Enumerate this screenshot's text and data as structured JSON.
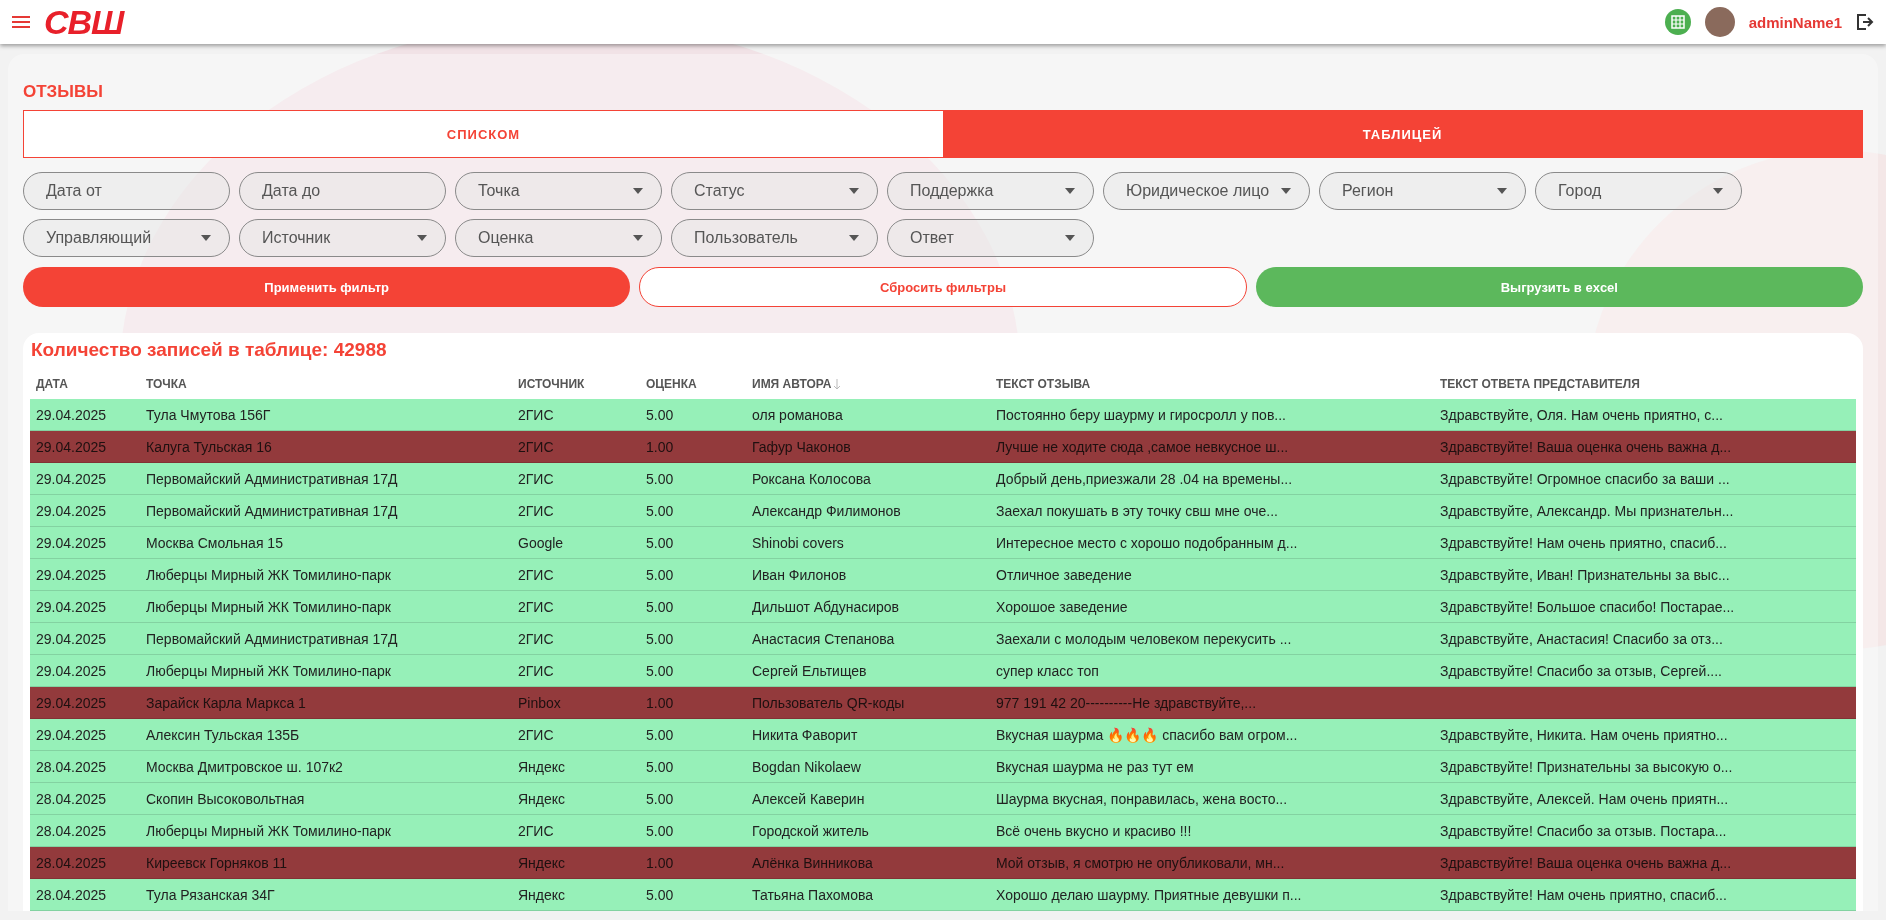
{
  "header": {
    "logo": "СВШ",
    "user": "adminName1"
  },
  "page_title": "ОТЗЫВЫ",
  "tabs": [
    {
      "label": "СПИСКОМ",
      "selected": false
    },
    {
      "label": "ТАБЛИЦЕЙ",
      "selected": true
    }
  ],
  "filters": [
    {
      "kind": "date",
      "placeholder": "Дата от"
    },
    {
      "kind": "date",
      "placeholder": "Дата до"
    },
    {
      "kind": "select",
      "label": "Точка"
    },
    {
      "kind": "select",
      "label": "Статус"
    },
    {
      "kind": "select",
      "label": "Поддержка"
    },
    {
      "kind": "select",
      "label": "Юридическое лицо"
    },
    {
      "kind": "select",
      "label": "Регион"
    },
    {
      "kind": "select",
      "label": "Город"
    },
    {
      "kind": "select",
      "label": "Управляющий"
    },
    {
      "kind": "select",
      "label": "Источник"
    },
    {
      "kind": "select",
      "label": "Оценка"
    },
    {
      "kind": "select",
      "label": "Пользователь"
    },
    {
      "kind": "select",
      "label": "Ответ"
    }
  ],
  "actions": [
    {
      "kind": "primary",
      "label": "Применить фильтр"
    },
    {
      "kind": "outline",
      "label": "Сбросить фильтры"
    },
    {
      "kind": "success",
      "label": "Выгрузить в excel"
    }
  ],
  "table": {
    "count_label": "Количество записей в таблице: 42988",
    "columns": [
      {
        "label": "ДАТА",
        "sorted": false
      },
      {
        "label": "ТОЧКА",
        "sorted": false
      },
      {
        "label": "ИСТОЧНИК",
        "sorted": false
      },
      {
        "label": "ОЦЕНКА",
        "sorted": false
      },
      {
        "label": "ИМЯ АВТОРА",
        "sorted": true
      },
      {
        "label": "ТЕКСТ ОТЗЫВА",
        "sorted": false
      },
      {
        "label": "ТЕКСТ ОТВЕТА ПРЕДСТАВИТЕЛЯ",
        "sorted": false
      }
    ],
    "rows": [
      {
        "color": "#96f0b8",
        "cells": [
          "29.04.2025",
          "Тула Чмутова 156Г",
          "2ГИС",
          "5.00",
          "оля романова",
          "Постоянно беру шаурму и гиросролл у пов...",
          "Здравствуйте, Оля. Нам очень приятно, с..."
        ]
      },
      {
        "color": "#933a3c",
        "cells": [
          "29.04.2025",
          "Калуга Тульская 16",
          "2ГИС",
          "1.00",
          "Гафур Чаконов",
          "Лучше не ходите сюда ,самое невкусное ш...",
          "Здравствуйте! Ваша оценка очень важна д..."
        ]
      },
      {
        "color": "#96f0b8",
        "cells": [
          "29.04.2025",
          "Первомайский Административная 17Д",
          "2ГИС",
          "5.00",
          "Роксана Колосова",
          "Добрый день,приезжали 28 .04 на времены...",
          "Здравствуйте! Огромное спасибо за ваши ..."
        ]
      },
      {
        "color": "#96f0b8",
        "cells": [
          "29.04.2025",
          "Первомайский Административная 17Д",
          "2ГИС",
          "5.00",
          "Александр Филимонов",
          "Заехал покушать в эту точку свш мне оче...",
          "Здравствуйте, Александр. Мы признательн..."
        ]
      },
      {
        "color": "#96f0b8",
        "cells": [
          "29.04.2025",
          "Москва Смольная 15",
          "Google",
          "5.00",
          "Shinobi covers",
          "Интересное место с хорошо подобранным д...",
          "Здравствуйте! Нам очень приятно, спасиб..."
        ]
      },
      {
        "color": "#96f0b8",
        "cells": [
          "29.04.2025",
          "Люберцы Мирный ЖК Томилино-парк",
          "2ГИС",
          "5.00",
          "Иван Филонов",
          "Отличное заведение",
          "Здравствуйте, Иван! Признательны за выс..."
        ]
      },
      {
        "color": "#96f0b8",
        "cells": [
          "29.04.2025",
          "Люберцы Мирный ЖК Томилино-парк",
          "2ГИС",
          "5.00",
          "Дильшот Абдунасиров",
          "Хорошое заведение",
          "Здравствуйте! Большое спасибо! Постарае..."
        ]
      },
      {
        "color": "#96f0b8",
        "cells": [
          "29.04.2025",
          "Первомайский Административная 17Д",
          "2ГИС",
          "5.00",
          "Анастасия Степанова",
          "Заехали с молодым человеком перекусить ...",
          "Здравствуйте, Анастасия! Спасибо за отз..."
        ]
      },
      {
        "color": "#96f0b8",
        "cells": [
          "29.04.2025",
          "Люберцы Мирный ЖК Томилино-парк",
          "2ГИС",
          "5.00",
          "Сергей Ельтищев",
          "супер класс топ",
          "Здравствуйте! Спасибо за отзыв, Сергей...."
        ]
      },
      {
        "color": "#933a3c",
        "cells": [
          "29.04.2025",
          "Зарайск Карла Маркса 1",
          "Pinbox",
          "1.00",
          "Пользователь QR-коды",
          "977 191 42 20----------Не здравствуйте,...",
          null
        ]
      },
      {
        "color": "#96f0b8",
        "cells": [
          "29.04.2025",
          "Алексин Тульская 135Б",
          "2ГИС",
          "5.00",
          "Никита Фаворит",
          "Вкусная шаурма 🔥🔥🔥 спасибо вам огром...",
          "Здравствуйте, Никита. Нам очень приятно..."
        ]
      },
      {
        "color": "#96f0b8",
        "cells": [
          "28.04.2025",
          "Москва Дмитровское ш. 107к2",
          "Яндекс",
          "5.00",
          "Bogdan Nikolaew",
          "Вкусная шаурма не раз тут ем",
          "Здравствуйте! Признательны за высокую о..."
        ]
      },
      {
        "color": "#96f0b8",
        "cells": [
          "28.04.2025",
          "Скопин Высоковольтная",
          "Яндекс",
          "5.00",
          "Алексей Каверин",
          "Шаурма вкусная, понравилась, жена восто...",
          "Здравствуйте, Алексей. Нам очень приятн..."
        ]
      },
      {
        "color": "#96f0b8",
        "cells": [
          "28.04.2025",
          "Люберцы Мирный ЖК Томилино-парк",
          "2ГИС",
          "5.00",
          "Городской житель",
          "Всё очень вкусно и красиво !!!",
          "Здравствуйте! Спасибо за отзыв. Постара..."
        ]
      },
      {
        "color": "#933a3c",
        "cells": [
          "28.04.2025",
          "Киреевск Горняков 11",
          "Яндекс",
          "1.00",
          "Алёнка Винникова",
          "Мой отзыв, я смотрю не опубликовали, мн...",
          "Здравствуйте! Ваша оценка очень важна д..."
        ]
      },
      {
        "color": "#96f0b8",
        "cells": [
          "28.04.2025",
          "Тула Рязанская 34Г",
          "Яндекс",
          "5.00",
          "Татьяна Пахомова",
          "Хорошо делаю шаурму. Приятные девушки п...",
          "Здравствуйте! Нам очень приятно, спасиб..."
        ]
      }
    ]
  }
}
